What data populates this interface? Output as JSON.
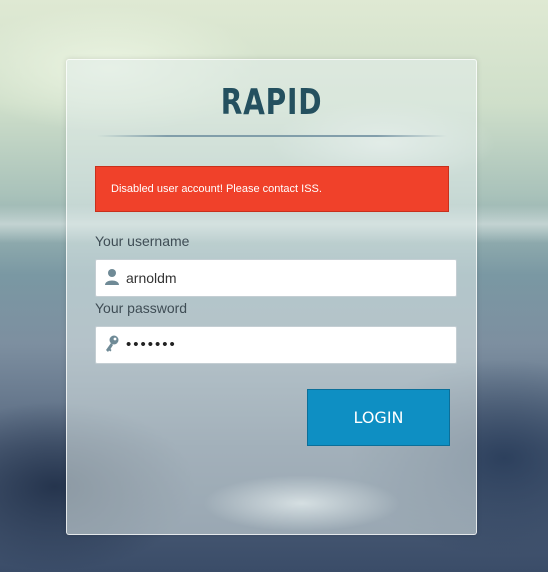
{
  "brand": {
    "name": "RAPID"
  },
  "alert": {
    "message": "Disabled user account! Please contact ISS."
  },
  "form": {
    "username_label": "Your username",
    "username_value": "arnoldm",
    "password_label": "Your password",
    "password_mask": "•••••••",
    "login_label": "LOGIN"
  },
  "icons": {
    "username": "user-icon",
    "password": "key-icon"
  },
  "colors": {
    "brand_text": "#24505f",
    "alert_bg": "#f0412a",
    "button_bg": "#0e8fc3"
  }
}
